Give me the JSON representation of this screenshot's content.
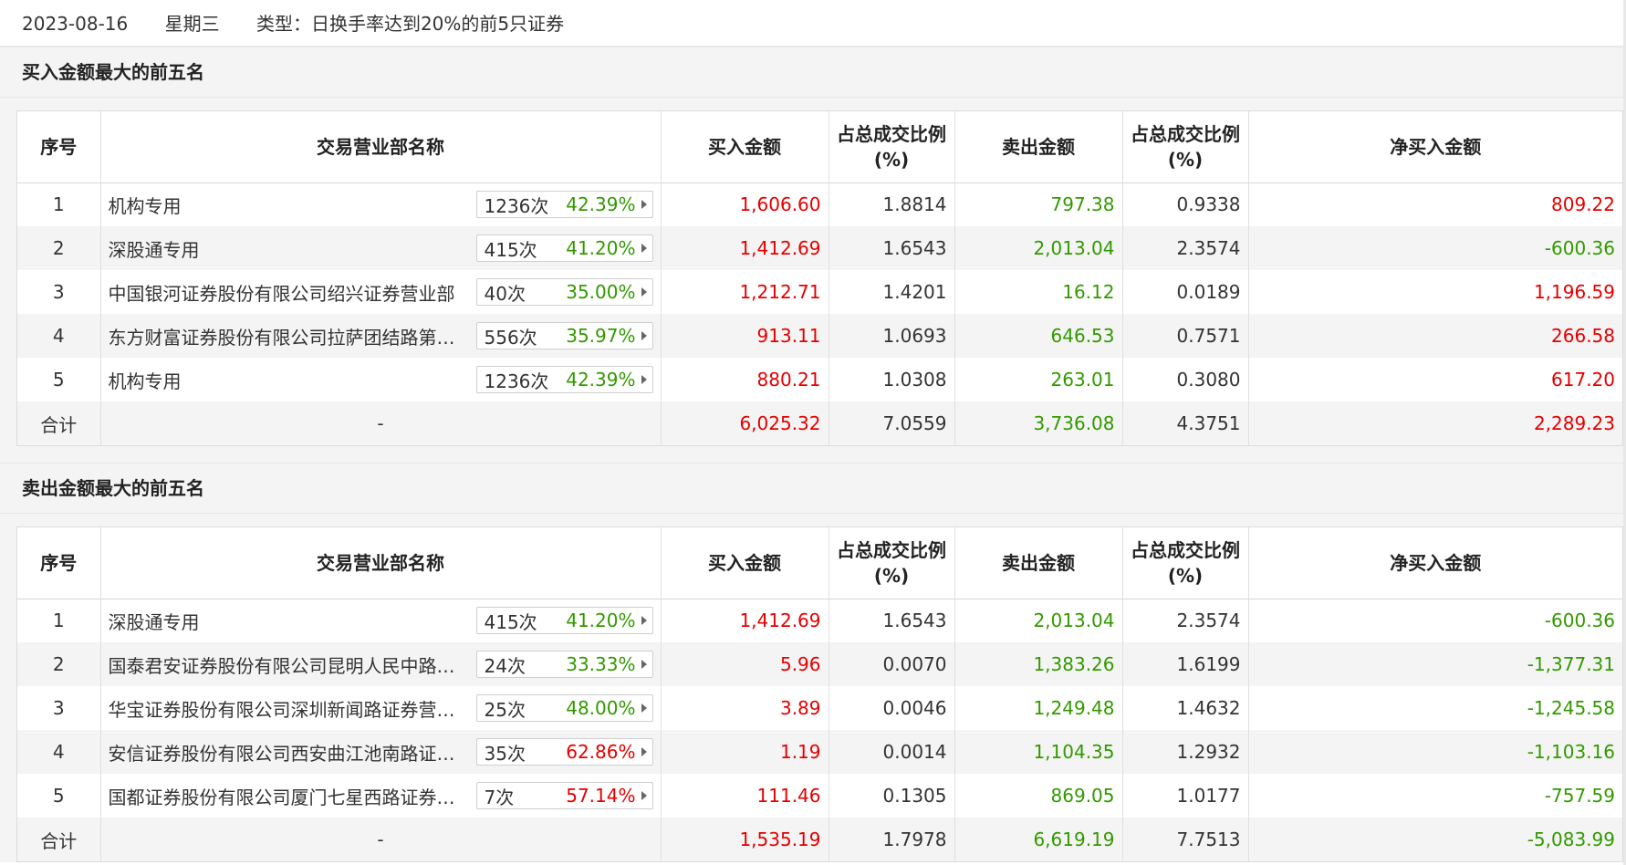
{
  "header": {
    "date": "2023-08-16",
    "weekday": "星期三",
    "type_text": "类型：日换手率达到20%的前5只证券"
  },
  "colors": {
    "red": "#e40000",
    "green": "#339900",
    "stripe": "#f4f4f4"
  },
  "columns": [
    "序号",
    "交易营业部名称",
    "买入金额",
    "占总成交比例(%)",
    "卖出金额",
    "占总成交比例(%)",
    "净买入金额"
  ],
  "buy_section": {
    "title": "买入金额最大的前五名",
    "rows": [
      {
        "no": "1",
        "name": "机构专用",
        "count": "1236次",
        "pct": "42.39%",
        "pct_color": "green",
        "buy": "1,606.60",
        "buy_ratio": "1.8814",
        "sell": "797.38",
        "sell_ratio": "0.9338",
        "net": "809.22",
        "net_color": "red"
      },
      {
        "no": "2",
        "name": "深股通专用",
        "count": "415次",
        "pct": "41.20%",
        "pct_color": "green",
        "buy": "1,412.69",
        "buy_ratio": "1.6543",
        "sell": "2,013.04",
        "sell_ratio": "2.3574",
        "net": "-600.36",
        "net_color": "green"
      },
      {
        "no": "3",
        "name": "中国银河证券股份有限公司绍兴证券营业部",
        "count": "40次",
        "pct": "35.00%",
        "pct_color": "green",
        "buy": "1,212.71",
        "buy_ratio": "1.4201",
        "sell": "16.12",
        "sell_ratio": "0.0189",
        "net": "1,196.59",
        "net_color": "red"
      },
      {
        "no": "4",
        "name": "东方财富证券股份有限公司拉萨团结路第一证券营业部",
        "count": "556次",
        "pct": "35.97%",
        "pct_color": "green",
        "buy": "913.11",
        "buy_ratio": "1.0693",
        "sell": "646.53",
        "sell_ratio": "0.7571",
        "net": "266.58",
        "net_color": "red"
      },
      {
        "no": "5",
        "name": "机构专用",
        "count": "1236次",
        "pct": "42.39%",
        "pct_color": "green",
        "buy": "880.21",
        "buy_ratio": "1.0308",
        "sell": "263.01",
        "sell_ratio": "0.3080",
        "net": "617.20",
        "net_color": "red"
      }
    ],
    "total": {
      "label": "合计",
      "name": "-",
      "buy": "6,025.32",
      "buy_ratio": "7.0559",
      "sell": "3,736.08",
      "sell_ratio": "4.3751",
      "net": "2,289.23",
      "net_color": "red"
    }
  },
  "sell_section": {
    "title": "卖出金额最大的前五名",
    "rows": [
      {
        "no": "1",
        "name": "深股通专用",
        "count": "415次",
        "pct": "41.20%",
        "pct_color": "green",
        "buy": "1,412.69",
        "buy_ratio": "1.6543",
        "sell": "2,013.04",
        "sell_ratio": "2.3574",
        "net": "-600.36",
        "net_color": "green"
      },
      {
        "no": "2",
        "name": "国泰君安证券股份有限公司昆明人民中路证券营业部",
        "count": "24次",
        "pct": "33.33%",
        "pct_color": "green",
        "buy": "5.96",
        "buy_ratio": "0.0070",
        "sell": "1,383.26",
        "sell_ratio": "1.6199",
        "net": "-1,377.31",
        "net_color": "green"
      },
      {
        "no": "3",
        "name": "华宝证券股份有限公司深圳新闻路证券营业部",
        "count": "25次",
        "pct": "48.00%",
        "pct_color": "green",
        "buy": "3.89",
        "buy_ratio": "0.0046",
        "sell": "1,249.48",
        "sell_ratio": "1.4632",
        "net": "-1,245.58",
        "net_color": "green"
      },
      {
        "no": "4",
        "name": "安信证券股份有限公司西安曲江池南路证券营业部",
        "count": "35次",
        "pct": "62.86%",
        "pct_color": "red",
        "buy": "1.19",
        "buy_ratio": "0.0014",
        "sell": "1,104.35",
        "sell_ratio": "1.2932",
        "net": "-1,103.16",
        "net_color": "green"
      },
      {
        "no": "5",
        "name": "国都证券股份有限公司厦门七星西路证券营业部",
        "count": "7次",
        "pct": "57.14%",
        "pct_color": "red",
        "buy": "111.46",
        "buy_ratio": "0.1305",
        "sell": "869.05",
        "sell_ratio": "1.0177",
        "net": "-757.59",
        "net_color": "green"
      }
    ],
    "total": {
      "label": "合计",
      "name": "-",
      "buy": "1,535.19",
      "buy_ratio": "1.7978",
      "sell": "6,619.19",
      "sell_ratio": "7.7513",
      "net": "-5,083.99",
      "net_color": "green"
    }
  }
}
